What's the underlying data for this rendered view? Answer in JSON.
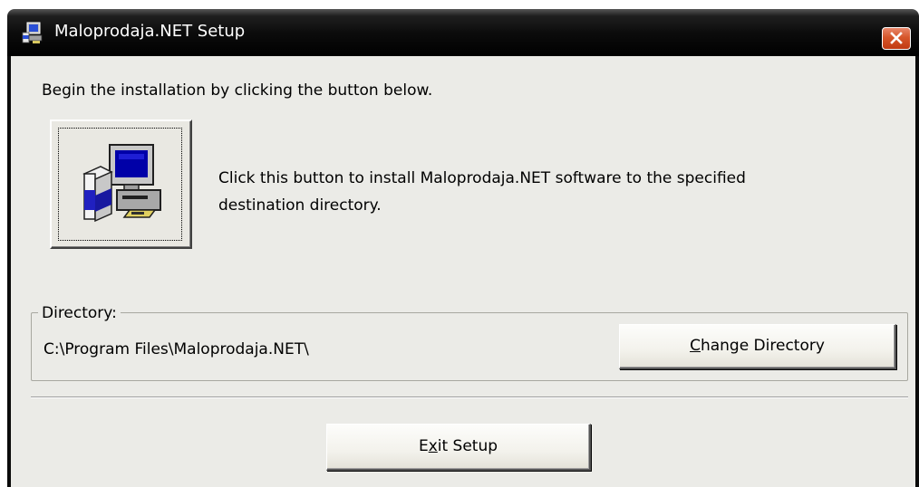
{
  "window": {
    "title": "Maloprodaja.NET Setup",
    "icon": "setup-computer-icon",
    "close_icon": "close-icon"
  },
  "dialog": {
    "instruction": "Begin the installation by clicking the button below.",
    "install_button_icon": "install-computer-icon",
    "install_description_line1": "Click this button to install Maloprodaja.NET software to the specified",
    "install_description_line2": "destination directory.",
    "directory_group_label": "Directory:",
    "directory_path": "C:\\Program Files\\Maloprodaja.NET\\",
    "change_directory": {
      "before": "",
      "mnemonic": "C",
      "after": "hange Directory"
    },
    "exit_setup": {
      "before": "E",
      "mnemonic": "x",
      "after": "it Setup"
    }
  },
  "colors": {
    "titlebar": "#000000",
    "client_background": "#ebebe7",
    "close_button": "#d6562a"
  }
}
